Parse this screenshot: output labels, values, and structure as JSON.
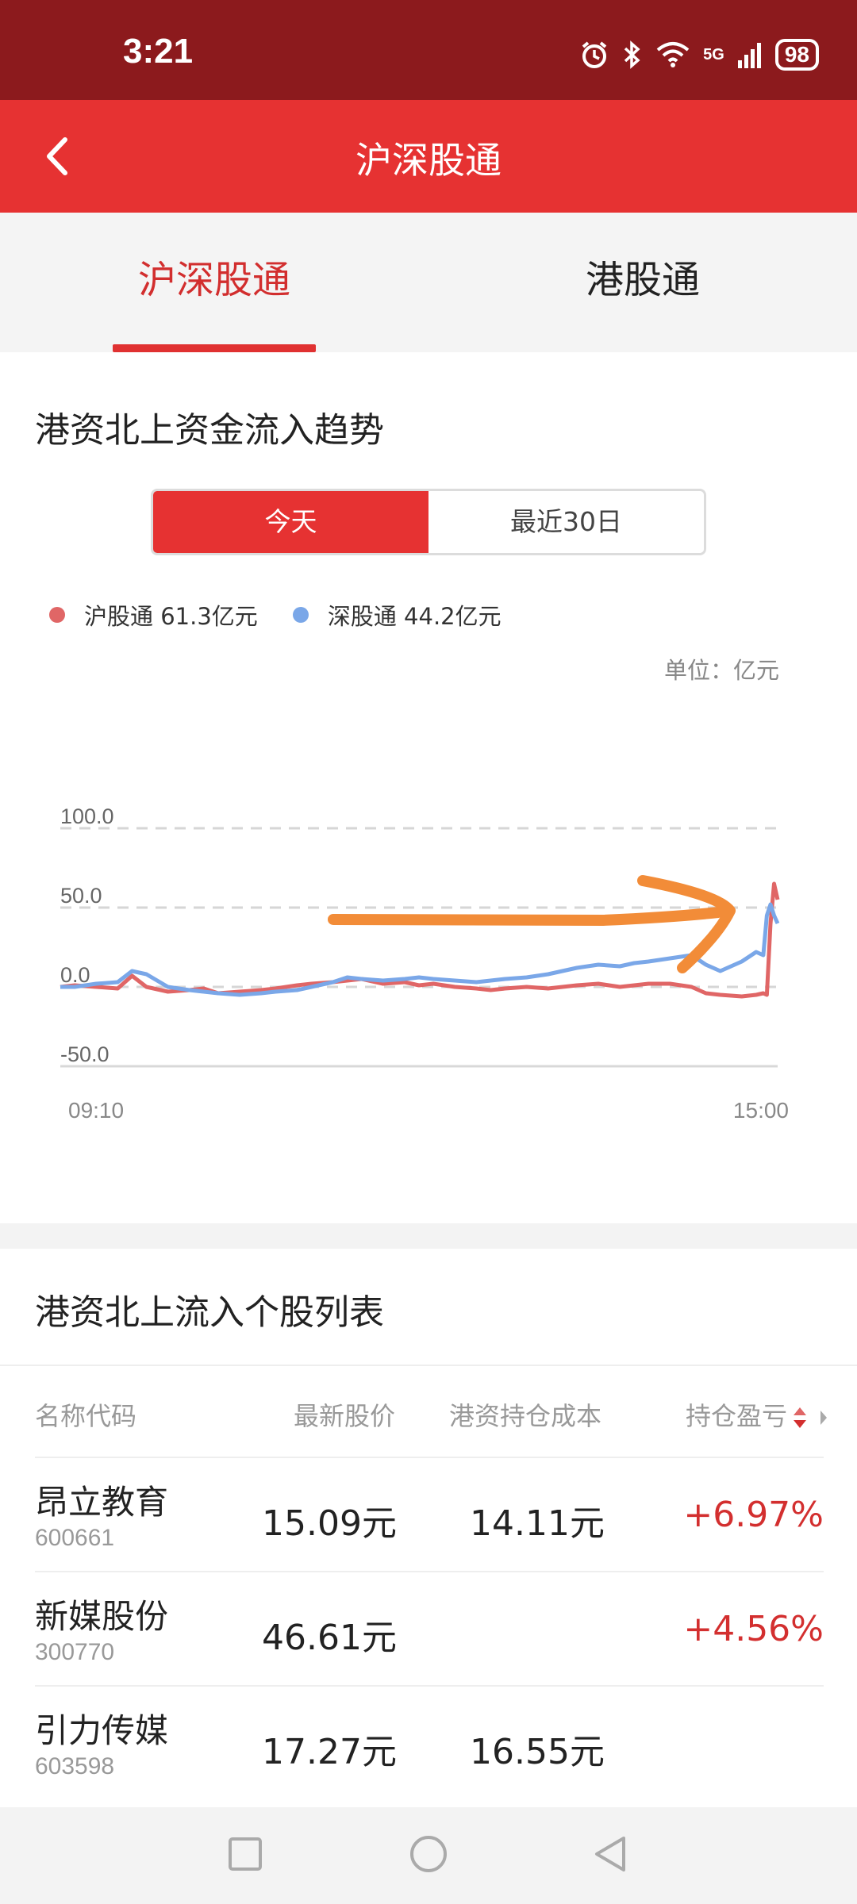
{
  "status_bar": {
    "time": "3:21",
    "network": "5G",
    "battery": "98"
  },
  "app_bar": {
    "title": "沪深股通"
  },
  "tabs": [
    {
      "label": "沪深股通"
    },
    {
      "label": "港股通"
    }
  ],
  "trend": {
    "title": "港资北上资金流入趋势",
    "range_tabs": [
      {
        "label": "今天"
      },
      {
        "label": "最近30日"
      }
    ],
    "legend": [
      {
        "name": "沪股通",
        "value": "61.3亿元",
        "color": "#e06666"
      },
      {
        "name": "深股通",
        "value": "44.2亿元",
        "color": "#7aa7e8"
      }
    ],
    "unit": "单位：亿元"
  },
  "chart_data": {
    "type": "line",
    "y_ticks": [
      "100.0",
      "50.0",
      "0.0",
      "-50.0"
    ],
    "ylim": [
      -50,
      100
    ],
    "x_ticks": [
      "09:10",
      "15:00"
    ],
    "grid": true,
    "series": [
      {
        "name": "沪股通",
        "color": "#e06666",
        "x": [
          0,
          0.02,
          0.05,
          0.08,
          0.1,
          0.12,
          0.15,
          0.18,
          0.2,
          0.22,
          0.25,
          0.28,
          0.3,
          0.33,
          0.35,
          0.38,
          0.4,
          0.42,
          0.45,
          0.48,
          0.5,
          0.52,
          0.55,
          0.58,
          0.6,
          0.62,
          0.65,
          0.68,
          0.7,
          0.72,
          0.75,
          0.78,
          0.8,
          0.82,
          0.85,
          0.88,
          0.9,
          0.92,
          0.95,
          0.97,
          0.98,
          0.985,
          0.99,
          0.995,
          1.0
        ],
        "values": [
          0,
          1,
          0,
          -1,
          7,
          0,
          -3,
          -2,
          -1,
          -4,
          -3,
          -2,
          -1,
          1,
          2,
          3,
          4,
          5,
          2,
          3,
          1,
          2,
          0,
          -1,
          -2,
          -1,
          0,
          -1,
          0,
          1,
          2,
          0,
          1,
          2,
          2,
          0,
          -4,
          -5,
          -6,
          -5,
          -4,
          -5,
          40,
          65,
          55
        ]
      },
      {
        "name": "深股通",
        "color": "#7aa7e8",
        "x": [
          0,
          0.02,
          0.05,
          0.08,
          0.1,
          0.12,
          0.15,
          0.18,
          0.2,
          0.22,
          0.25,
          0.28,
          0.3,
          0.33,
          0.35,
          0.38,
          0.4,
          0.42,
          0.45,
          0.48,
          0.5,
          0.52,
          0.55,
          0.58,
          0.6,
          0.62,
          0.65,
          0.68,
          0.7,
          0.72,
          0.75,
          0.78,
          0.8,
          0.82,
          0.85,
          0.88,
          0.9,
          0.92,
          0.95,
          0.97,
          0.98,
          0.985,
          0.99,
          0.995,
          1.0
        ],
        "values": [
          0,
          0,
          2,
          3,
          10,
          8,
          0,
          -2,
          -3,
          -4,
          -5,
          -4,
          -3,
          -2,
          0,
          3,
          6,
          5,
          4,
          5,
          6,
          5,
          4,
          3,
          4,
          5,
          6,
          8,
          10,
          12,
          14,
          13,
          15,
          16,
          18,
          20,
          14,
          10,
          16,
          22,
          20,
          45,
          52,
          45,
          40
        ]
      }
    ]
  },
  "stock_list": {
    "title": "港资北上流入个股列表",
    "columns": [
      "名称代码",
      "最新股价",
      "港资持仓成本",
      "持仓盈亏"
    ],
    "rows": [
      {
        "name": "昂立教育",
        "code": "600661",
        "price": "15.09元",
        "cost": "14.11元",
        "pl": "+6.97%"
      },
      {
        "name": "新媒股份",
        "code": "300770",
        "price": "46.61元",
        "cost": "",
        "pl": "+4.56%"
      },
      {
        "name": "引力传媒",
        "code": "603598",
        "price": "17.27元",
        "cost": "16.55元",
        "pl": ""
      }
    ]
  },
  "colors": {
    "status_bar": "#8c1a1d",
    "app_bar": "#e63232",
    "accent": "#e03131",
    "positive": "#d32f2f",
    "annotation": "#f28c38"
  },
  "icons": [
    "back-icon",
    "alarm-icon",
    "bluetooth-icon",
    "wifi-icon",
    "signal-icon",
    "sort-icon",
    "recents-icon",
    "home-icon",
    "nav-back-icon"
  ]
}
